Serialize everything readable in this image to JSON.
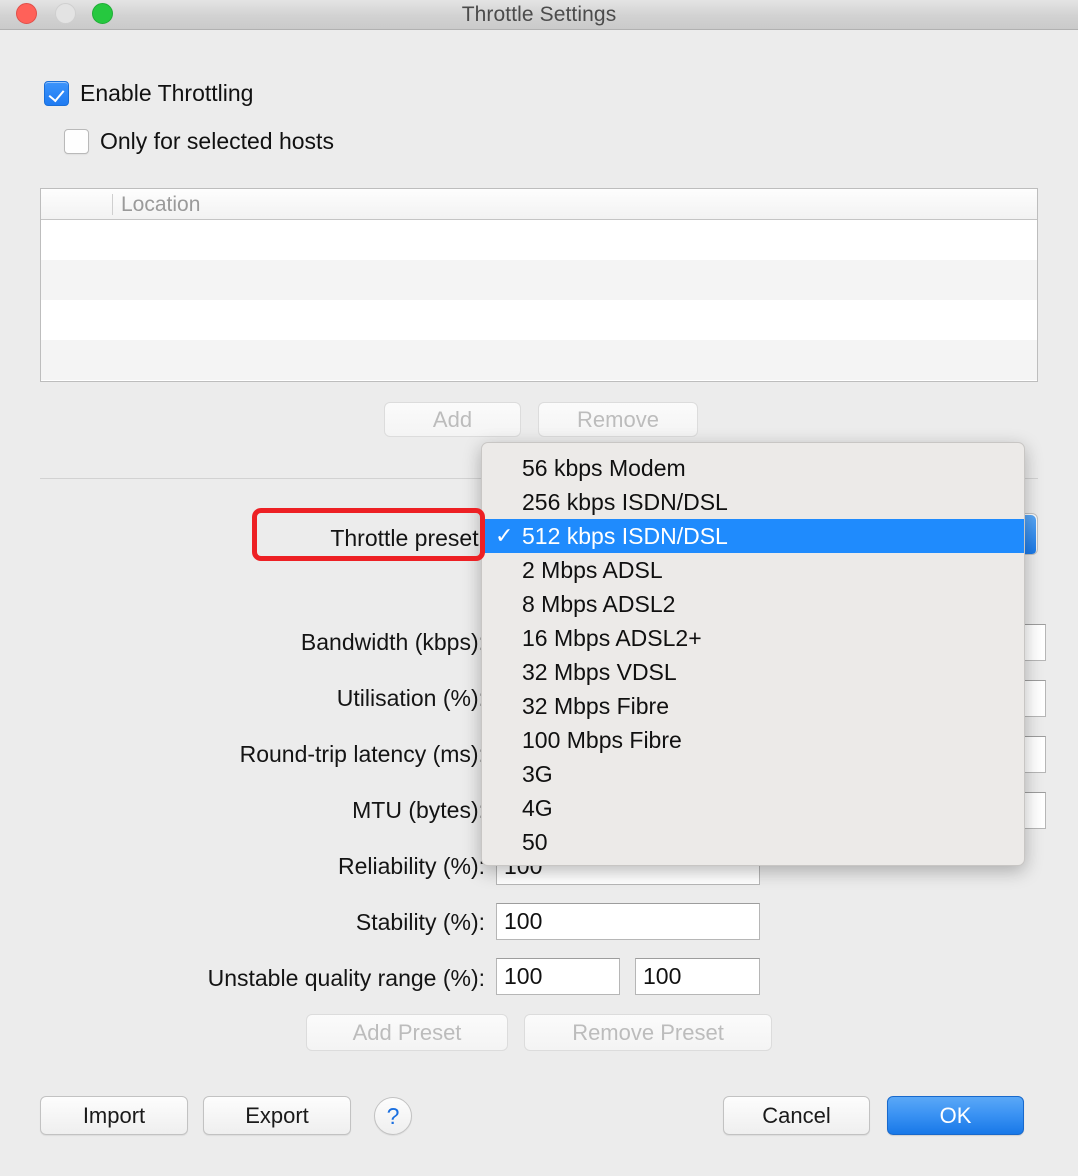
{
  "window": {
    "title": "Throttle Settings",
    "traffic_lights": [
      "close-button",
      "minimize-button",
      "zoom-button"
    ],
    "accent_blue": "#1f8bfd",
    "annotation_color": "#ed2024"
  },
  "options": {
    "enable_throttling": {
      "label": "Enable Throttling",
      "checked": true
    },
    "only_selected_hosts": {
      "label": "Only for selected hosts",
      "checked": false
    }
  },
  "hosts_table": {
    "columns": [
      "",
      "Location"
    ],
    "rows": [],
    "empty_row_count": 4
  },
  "table_buttons": {
    "add": {
      "label": "Add",
      "enabled": false
    },
    "remove": {
      "label": "Remove",
      "enabled": false
    }
  },
  "form": {
    "throttle_preset": {
      "label": "Throttle preset:",
      "selected": "512 kbps ISDN/DSL",
      "menu_open": true,
      "options": [
        "56 kbps Modem",
        "256 kbps ISDN/DSL",
        "512 kbps ISDN/DSL",
        "2 Mbps ADSL",
        "8 Mbps ADSL2",
        "16 Mbps ADSL2+",
        "32 Mbps VDSL",
        "32 Mbps Fibre",
        "100 Mbps Fibre",
        "3G",
        "4G",
        "50"
      ],
      "selected_index": 2,
      "checkmark": "✓"
    },
    "bandwidth": {
      "label": "Bandwidth (kbps):",
      "value": ""
    },
    "utilisation": {
      "label": "Utilisation (%):",
      "value": ""
    },
    "latency": {
      "label": "Round-trip latency (ms):",
      "value": ""
    },
    "mtu": {
      "label": "MTU (bytes):",
      "value": ""
    },
    "reliability": {
      "label": "Reliability (%):",
      "value": "100"
    },
    "stability": {
      "label": "Stability (%):",
      "value": "100"
    },
    "unstable_range": {
      "label": "Unstable quality range (%):",
      "value_min": "100",
      "value_max": "100"
    }
  },
  "preset_buttons": {
    "add_preset": {
      "label": "Add Preset",
      "enabled": false
    },
    "remove_preset": {
      "label": "Remove Preset",
      "enabled": false
    }
  },
  "footer": {
    "import": {
      "label": "Import"
    },
    "export": {
      "label": "Export"
    },
    "help": {
      "label": "?"
    },
    "cancel": {
      "label": "Cancel"
    },
    "ok": {
      "label": "OK",
      "is_default": true
    }
  }
}
